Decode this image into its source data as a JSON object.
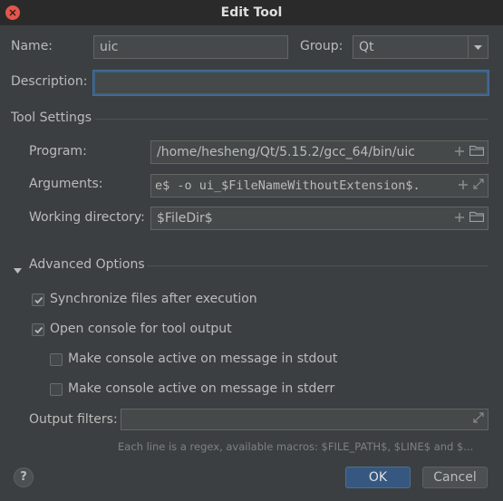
{
  "window": {
    "title": "Edit Tool"
  },
  "name": {
    "label": "Name:",
    "value": "uic"
  },
  "group": {
    "label": "Group:",
    "value": "Qt"
  },
  "description": {
    "label": "Description:",
    "value": ""
  },
  "tool_settings": {
    "header": "Tool Settings",
    "program": {
      "label": "Program:",
      "value": "/home/hesheng/Qt/5.15.2/gcc_64/bin/uic"
    },
    "arguments": {
      "label": "Arguments:",
      "value": "e$ -o ui_$FileNameWithoutExtension$."
    },
    "working_directory": {
      "label": "Working directory:",
      "value": "$FileDir$"
    }
  },
  "advanced_options": {
    "header": "Advanced Options",
    "sync_files": {
      "label": "Synchronize files after execution",
      "checked": true
    },
    "open_console": {
      "label": "Open console for tool output",
      "checked": true
    },
    "console_active_stdout": {
      "label": "Make console active on message in stdout",
      "checked": false
    },
    "console_active_stderr": {
      "label": "Make console active on message in stderr",
      "checked": false
    },
    "output_filters": {
      "label": "Output filters:",
      "value": ""
    },
    "hint": "Each line is a regex, available macros: $FILE_PATH$, $LINE$ and $..."
  },
  "buttons": {
    "help": "?",
    "ok": "OK",
    "cancel": "Cancel"
  },
  "colors": {
    "accent": "#365880",
    "focus": "#3d6185",
    "background": "#3c3f41",
    "close": "#e2574c"
  }
}
